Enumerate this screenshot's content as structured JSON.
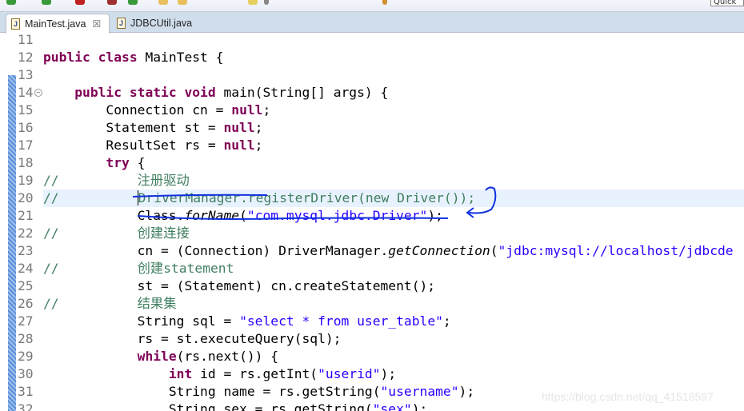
{
  "toolbar": {
    "quick_access": "Quick A"
  },
  "tabs": [
    {
      "label": "MainTest.java",
      "active": true,
      "close": "☒"
    },
    {
      "label": "JDBCUtil.java",
      "active": false
    }
  ],
  "editor": {
    "highlight_line": "20",
    "lines": [
      {
        "n": "11",
        "tokens": []
      },
      {
        "n": "12",
        "tokens": [
          {
            "t": "public class ",
            "c": "kw"
          },
          {
            "t": "MainTest {",
            "c": ""
          }
        ]
      },
      {
        "n": "13",
        "tokens": []
      },
      {
        "n": "14",
        "fold": true,
        "tokens": [
          {
            "t": "    ",
            "c": ""
          },
          {
            "t": "public static void ",
            "c": "kw"
          },
          {
            "t": "main(String[] args) {",
            "c": ""
          }
        ]
      },
      {
        "n": "15",
        "tokens": [
          {
            "t": "        Connection cn = ",
            "c": ""
          },
          {
            "t": "null",
            "c": "kw"
          },
          {
            "t": ";",
            "c": ""
          }
        ]
      },
      {
        "n": "16",
        "tokens": [
          {
            "t": "        Statement st = ",
            "c": ""
          },
          {
            "t": "null",
            "c": "kw"
          },
          {
            "t": ";",
            "c": ""
          }
        ]
      },
      {
        "n": "17",
        "tokens": [
          {
            "t": "        ResultSet rs = ",
            "c": ""
          },
          {
            "t": "null",
            "c": "kw"
          },
          {
            "t": ";",
            "c": ""
          }
        ]
      },
      {
        "n": "18",
        "tokens": [
          {
            "t": "        ",
            "c": ""
          },
          {
            "t": "try",
            "c": "kw"
          },
          {
            "t": " {",
            "c": ""
          }
        ]
      },
      {
        "n": "19",
        "tokens": [
          {
            "t": "//          注册驱动",
            "c": "cm"
          }
        ]
      },
      {
        "n": "20",
        "tokens": [
          {
            "t": "//          ",
            "c": "cm"
          },
          {
            "t": "DriverManager.registerDriver(new Driver());",
            "c": "cm caret"
          }
        ]
      },
      {
        "n": "21",
        "tokens": [
          {
            "t": "            Class.",
            "c": ""
          },
          {
            "t": "forName",
            "c": "it"
          },
          {
            "t": "(",
            "c": ""
          },
          {
            "t": "\"com.mysql.jdbc.Driver\"",
            "c": "str"
          },
          {
            "t": ");",
            "c": ""
          }
        ]
      },
      {
        "n": "22",
        "tokens": [
          {
            "t": "//          创建连接",
            "c": "cm"
          }
        ]
      },
      {
        "n": "23",
        "tokens": [
          {
            "t": "            cn = (Connection) DriverManager.",
            "c": ""
          },
          {
            "t": "getConnection",
            "c": "it"
          },
          {
            "t": "(",
            "c": ""
          },
          {
            "t": "\"jdbc:mysql://localhost/jdbcde",
            "c": "str"
          }
        ]
      },
      {
        "n": "24",
        "tokens": [
          {
            "t": "//          创建statement",
            "c": "cm"
          }
        ]
      },
      {
        "n": "25",
        "tokens": [
          {
            "t": "            st = (Statement) cn.createStatement();",
            "c": ""
          }
        ]
      },
      {
        "n": "26",
        "tokens": [
          {
            "t": "//          结果集",
            "c": "cm"
          }
        ]
      },
      {
        "n": "27",
        "tokens": [
          {
            "t": "            String sql = ",
            "c": ""
          },
          {
            "t": "\"select * from user_table\"",
            "c": "str"
          },
          {
            "t": ";",
            "c": ""
          }
        ]
      },
      {
        "n": "28",
        "tokens": [
          {
            "t": "            rs = st.executeQuery(sql);",
            "c": ""
          }
        ]
      },
      {
        "n": "29",
        "tokens": [
          {
            "t": "            ",
            "c": ""
          },
          {
            "t": "while",
            "c": "kw"
          },
          {
            "t": "(rs.next()) {",
            "c": ""
          }
        ]
      },
      {
        "n": "30",
        "tokens": [
          {
            "t": "                ",
            "c": ""
          },
          {
            "t": "int",
            "c": "kw"
          },
          {
            "t": " id = rs.getInt(",
            "c": ""
          },
          {
            "t": "\"userid\"",
            "c": "str"
          },
          {
            "t": ");",
            "c": ""
          }
        ]
      },
      {
        "n": "31",
        "tokens": [
          {
            "t": "                String name = rs.getString(",
            "c": ""
          },
          {
            "t": "\"username\"",
            "c": "str"
          },
          {
            "t": ");",
            "c": ""
          }
        ]
      },
      {
        "n": "32",
        "tokens": [
          {
            "t": "                String sex = rs.getString(",
            "c": ""
          },
          {
            "t": "\"sex\"",
            "c": "str"
          },
          {
            "t": ");",
            "c": ""
          }
        ]
      }
    ]
  },
  "watermark": "https://blog.csdn.net/qq_41518597",
  "colors": {
    "keyword": "#7f0055",
    "string": "#2a00ff",
    "comment": "#3f7f5f",
    "annotation": "#1030e0",
    "line_highlight": "#e8f2fe"
  }
}
